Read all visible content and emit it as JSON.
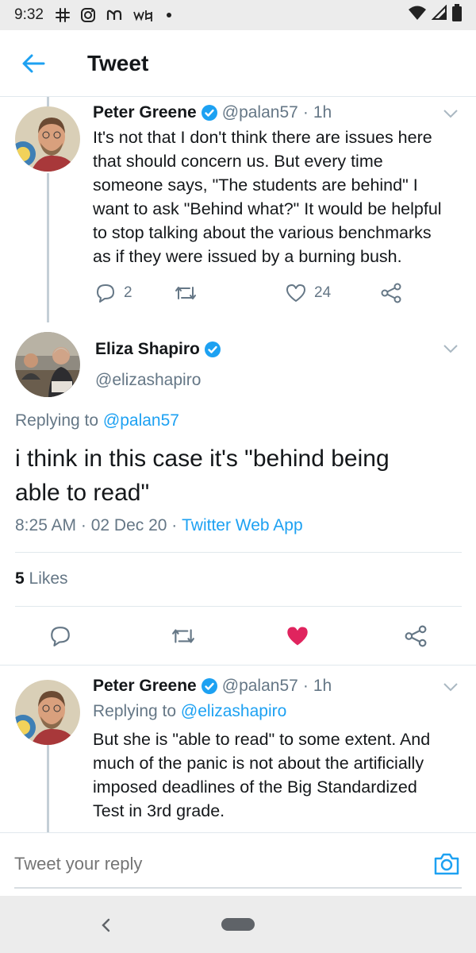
{
  "status_bar": {
    "time": "9:32"
  },
  "header": {
    "title": "Tweet"
  },
  "tweets": [
    {
      "name": "Peter Greene",
      "handle": "@palan57",
      "separator": "·",
      "time_ago": "1h",
      "text_lines": [
        "It's not that I don't think there are issues here",
        "that should concern us. But every time",
        "someone says, \"The students are behind\" I",
        "want to ask \"Behind what?\" It would be helpful",
        "to stop talking about the various benchmarks",
        "as if they were issued by a burning bush."
      ],
      "reply_count": "2",
      "like_count": "24"
    }
  ],
  "main_tweet": {
    "name": "Eliza Shapiro",
    "handle": "@elizashapiro",
    "replying_prefix": "Replying to",
    "replying_to": "@palan57",
    "text_lines": [
      "i think in this case it's \"behind being",
      "able to read\""
    ],
    "timestamp": "8:25 AM · 02 Dec 20 ·",
    "source": "Twitter Web App",
    "likes_count": "5",
    "likes_label": "Likes"
  },
  "reply_tweet": {
    "name": "Peter Greene",
    "handle": "@palan57",
    "separator": "·",
    "time_ago": "1h",
    "replying_prefix": "Replying to",
    "replying_to": "@elizashapiro",
    "text_lines": [
      "But she is \"able to read\" to some extent. And",
      "much of the panic is not about the artificially",
      "imposed deadlines of the Big Standardized",
      "Test in 3rd grade."
    ]
  },
  "reply_bar": {
    "placeholder": "Tweet your reply"
  },
  "colors": {
    "accent": "#1da1f2",
    "like_active": "#e0245e",
    "muted": "#657786",
    "verified": "#1da1f2"
  }
}
